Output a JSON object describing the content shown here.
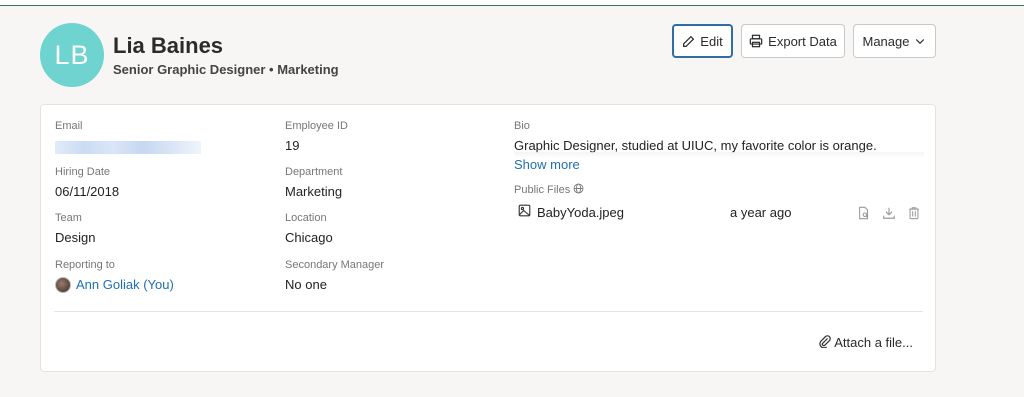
{
  "profile": {
    "initials": "LB",
    "name": "Lia Baines",
    "subtitle": "Senior Graphic Designer • Marketing",
    "avatar_color": "#6fd3cf"
  },
  "actions": {
    "edit_label": "Edit",
    "export_label": "Export Data",
    "manage_label": "Manage",
    "accent_color": "#2f6da5"
  },
  "details": {
    "email_label": "Email",
    "employee_id_label": "Employee ID",
    "employee_id": "19",
    "hiring_date_label": "Hiring Date",
    "hiring_date": "06/11/2018",
    "department_label": "Department",
    "department": "Marketing",
    "team_label": "Team",
    "team": "Design",
    "location_label": "Location",
    "location": "Chicago",
    "reporting_to_label": "Reporting to",
    "reporting_to": "Ann Goliak (You)",
    "secondary_manager_label": "Secondary Manager",
    "secondary_manager": "No one"
  },
  "bio": {
    "label": "Bio",
    "text": "Graphic Designer, studied at UIUC, my favorite color is orange.",
    "show_more": "Show more"
  },
  "files": {
    "label": "Public Files",
    "items": [
      {
        "name": "BabyYoda.jpeg",
        "modified": "a year ago"
      }
    ],
    "attach_label": "Attach a file..."
  },
  "icons": [
    "pencil-icon",
    "printer-icon",
    "chevron-down-icon",
    "globe-icon",
    "image-icon",
    "preview-icon",
    "download-icon",
    "trash-icon",
    "paperclip-icon"
  ]
}
